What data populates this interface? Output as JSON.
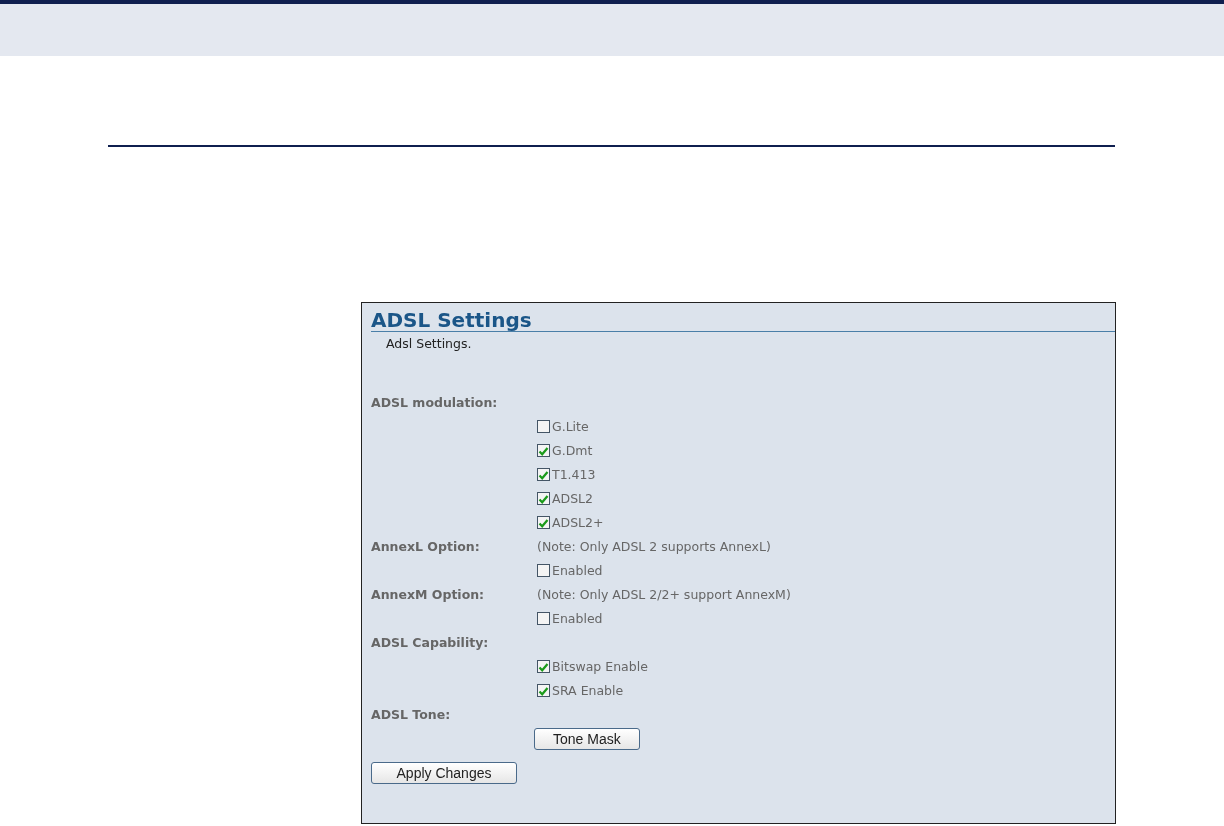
{
  "panel": {
    "title": "ADSL Settings",
    "description": "Adsl Settings.",
    "sections": [
      {
        "kind": "checkboxes",
        "label": "ADSL modulation:",
        "options": [
          {
            "label": "G.Lite",
            "checked": false
          },
          {
            "label": "G.Dmt",
            "checked": true
          },
          {
            "label": "T1.413",
            "checked": true
          },
          {
            "label": "ADSL2",
            "checked": true
          },
          {
            "label": "ADSL2+",
            "checked": true
          }
        ]
      },
      {
        "kind": "checkboxes",
        "label": "AnnexL Option:",
        "note": "(Note: Only ADSL 2 supports AnnexL)",
        "options": [
          {
            "label": "Enabled",
            "checked": false
          }
        ]
      },
      {
        "kind": "checkboxes",
        "label": "AnnexM Option:",
        "note": "(Note: Only ADSL 2/2+ support AnnexM)",
        "options": [
          {
            "label": "Enabled",
            "checked": false
          }
        ]
      },
      {
        "kind": "checkboxes",
        "label": "ADSL Capability:",
        "options": [
          {
            "label": "Bitswap Enable",
            "checked": true
          },
          {
            "label": "SRA Enable",
            "checked": true
          }
        ]
      },
      {
        "kind": "button",
        "label": "ADSL Tone:",
        "button": "Tone Mask"
      }
    ],
    "apply_button": "Apply Changes"
  }
}
